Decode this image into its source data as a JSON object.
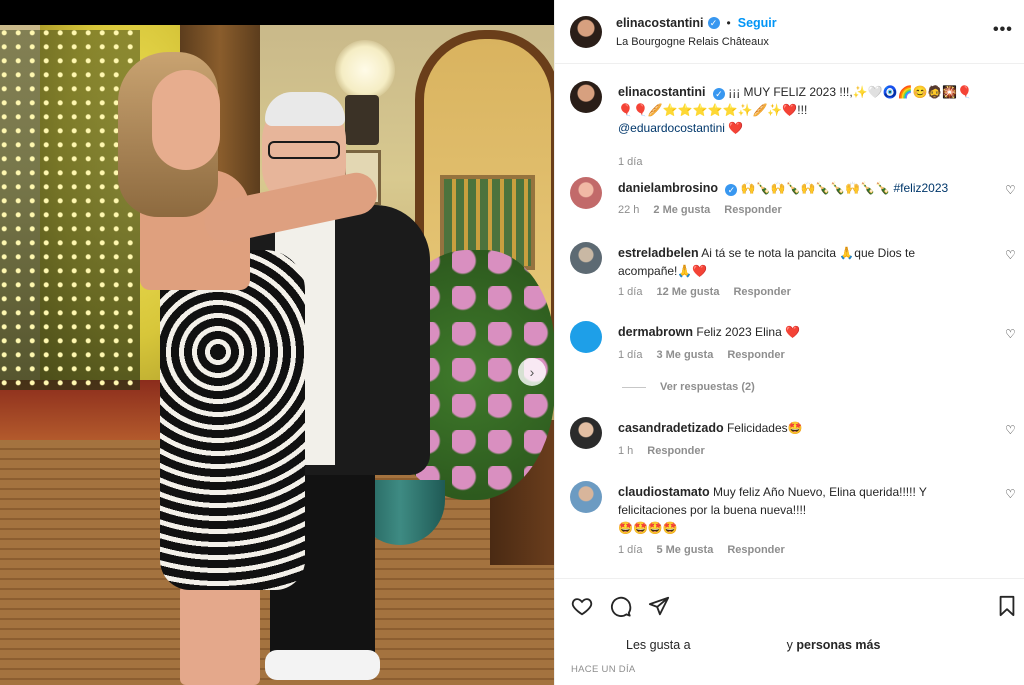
{
  "post": {
    "author": "elinacostantini",
    "follow_label": "Seguir",
    "separator": "•",
    "location": "La Bourgogne Relais Châteaux",
    "more_label": "•••"
  },
  "caption": {
    "username": "elinacostantini",
    "text": "¡¡¡ MUY FELIZ 2023 !!!,✨🤍🧿🌈😊🧔🎇🎈",
    "line2": "🎈🎈🥖⭐⭐⭐⭐⭐✨🥖✨❤️!!!",
    "mention": "@eduardocostantini",
    "mention_emoji": "❤️",
    "time": "1 día"
  },
  "comments": [
    {
      "username": "danielambrosino",
      "text": "🙌🍾🙌🍾🙌🍾🍾🙌🍾🍾",
      "hashtag": "#feliz2023",
      "time": "22 h",
      "likes": "2 Me gusta",
      "reply": "Responder"
    },
    {
      "username": "estreladbelen",
      "text": "Ai tá se te nota la pancita 🙏que Dios te acompañe!🙏❤️",
      "time": "1 día",
      "likes": "12 Me gusta",
      "reply": "Responder"
    },
    {
      "username": "dermabrown",
      "text": "Feliz 2023 Elina ❤️",
      "time": "1 día",
      "likes": "3 Me gusta",
      "reply": "Responder"
    },
    {
      "username": "casandradetizado",
      "text": "Felicidades🤩",
      "time": "1 h",
      "reply": "Responder"
    },
    {
      "username": "claudiostamato",
      "text": "Muy feliz Año Nuevo, Elina querida!!!!! Y felicitaciones por la buena nueva!!!!",
      "line2": "🤩🤩🤩🤩",
      "time": "1 día",
      "likes": "5 Me gusta",
      "reply": "Responder"
    }
  ],
  "view_replies": "Ver respuestas (2)",
  "likes_prefix": "Les gusta a",
  "likes_suffix_and": "y",
  "likes_suffix": "personas más",
  "posted_ago": "HACE UN DÍA",
  "icons": {
    "verified": "verified-badge-icon",
    "heart": "heart-icon",
    "comment": "comment-icon",
    "share": "paper-plane-icon",
    "save": "bookmark-icon",
    "carousel_next": "chevron-right-icon"
  },
  "colors": {
    "link_blue": "#0095f6",
    "verified_blue": "#3897f0",
    "muted": "#8e8e8e"
  }
}
